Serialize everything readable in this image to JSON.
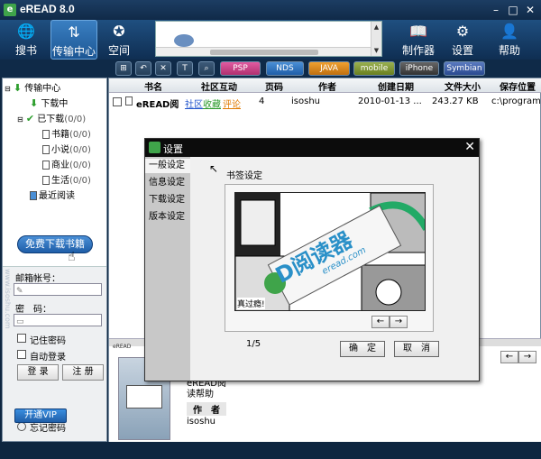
{
  "window": {
    "title": "eREAD 8.0"
  },
  "toolbar": {
    "search": "搜书",
    "transfer": "传输中心",
    "space": "空间",
    "maker": "制作器",
    "settings": "设置",
    "help": "帮助"
  },
  "formats": {
    "psp": "PSP",
    "nds": "NDS",
    "java": "JAVA",
    "mobile": "mobile",
    "iphone": "iPhone",
    "symbian": "Symbian"
  },
  "tree": {
    "root": "传输中心",
    "downloading": "下载中",
    "downloaded": "已下载",
    "downloaded_count": "(0/0)",
    "cat1": "书籍",
    "cat1_count": "(0/0)",
    "cat2": "小说",
    "cat2_count": "(0/0)",
    "cat3": "商业",
    "cat3_count": "(0/0)",
    "cat4": "生活",
    "cat4_count": "(0/0)",
    "recent": "最近阅读"
  },
  "free_download": "免费下载书籍",
  "login": {
    "email_label": "邮箱帐号：",
    "password_label": "密　码：",
    "remember": "记住密码",
    "auto_login": "自动登录",
    "login_btn": "登 录",
    "register_btn": "注 册",
    "vip": "开通VIP",
    "forgot": "忘记密码"
  },
  "table": {
    "headers": [
      "书名",
      "社区互动",
      "页码",
      "作者",
      "创建日期",
      "文件大小",
      "保存位置"
    ],
    "row": {
      "name": "eREAD阅",
      "community1": "社区",
      "community2": "收藏",
      "community3": "评论",
      "pages": "4",
      "author": "isoshu",
      "date": "2010-01-13 ...",
      "size": "243.27 KB",
      "path": "c:\\program"
    }
  },
  "lower": {
    "header": "eREAD",
    "book_title": "eREAD阅读帮助",
    "author_label": "作　者",
    "author": "isoshu"
  },
  "dialog": {
    "title": "设置",
    "tabs": [
      "一般设定",
      "信息设定",
      "下载设定",
      "版本设定"
    ],
    "section": "书签设定",
    "page_indicator": "1/5",
    "ok": "确　定",
    "cancel": "取　消"
  },
  "preview": {
    "brand": "D阅读器",
    "url": "eread.com",
    "caption": "真过瘾!"
  },
  "watermark": "www.isoshu.com"
}
